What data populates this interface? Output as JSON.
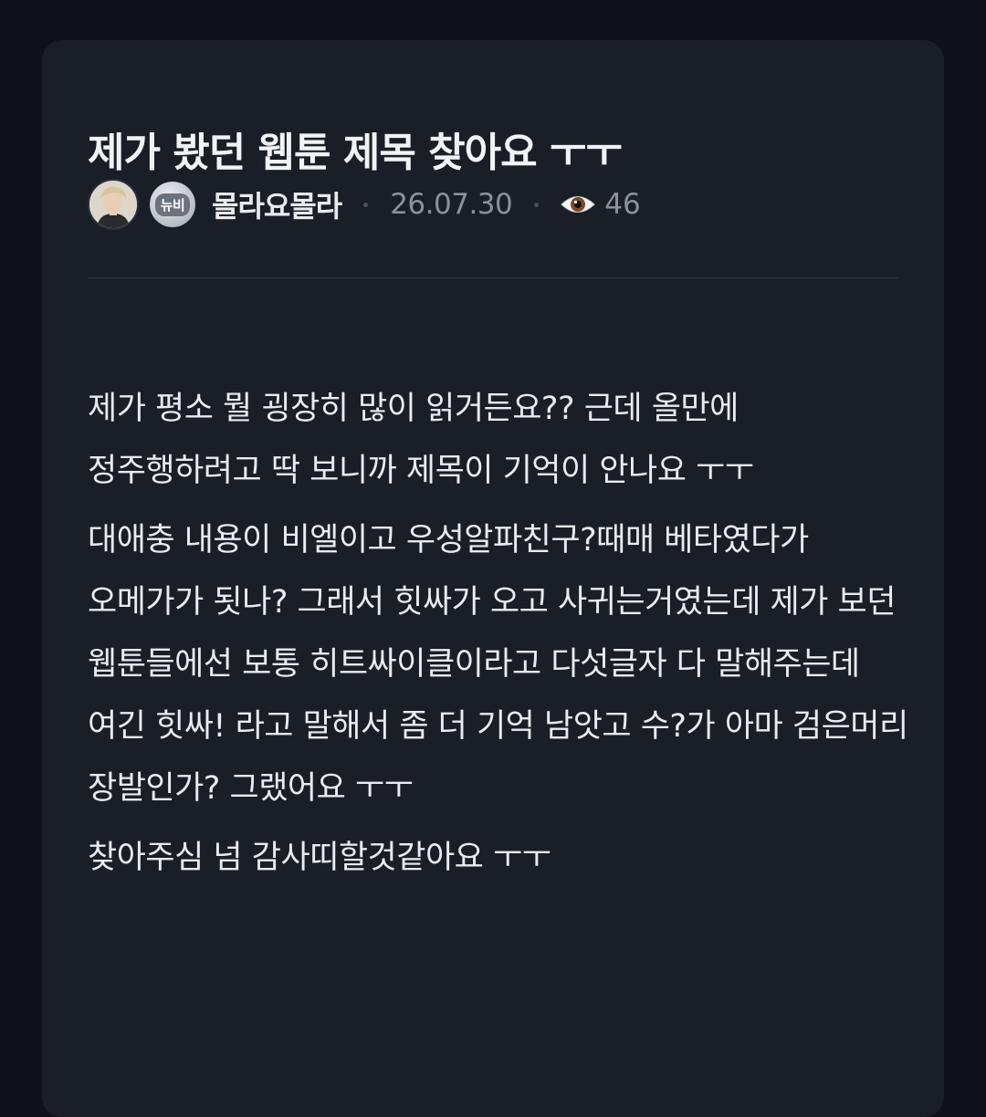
{
  "post": {
    "title": "제가 봤던 웹툰 제목 찾아요 ㅜㅜ",
    "author": "몰라요몰라",
    "level_badge": "뉴비",
    "date": "26.07.30",
    "views": "46",
    "paragraphs": [
      "제가 평소 뭘 굉장히 많이 읽거든요?? 근데 올만에 정주행하려고 딱 보니까 제목이 기억이 안나요 ㅜㅜ",
      "대애충 내용이 비엘이고 우성알파친구?때매 베타였다가 오메가가 됫나? 그래서 힛싸가 오고 사귀는거였는데 제가 보던 웹툰들에선 보통 히트싸이클이라고 다섯글자 다 말해주는데 여긴 힛싸! 라고 말해서 좀 더 기억 남앗고 수?가 아마 검은머리 장발인가? 그랬어요 ㅜㅜ",
      "찾아주심 넘 감사띠할것같아요 ㅜㅜ"
    ]
  },
  "icons": {
    "views": "eye-icon"
  },
  "colors": {
    "background": "#0f1218",
    "card": "#1a1e27",
    "text": "#e9ebef",
    "muted": "#8a909c"
  }
}
